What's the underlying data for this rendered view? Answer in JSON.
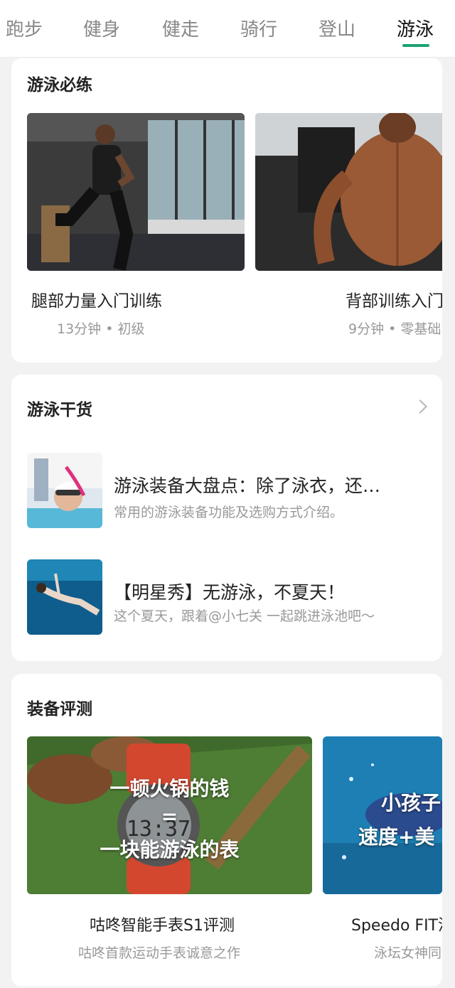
{
  "tabs": [
    {
      "label": "跑步"
    },
    {
      "label": "健身"
    },
    {
      "label": "健走"
    },
    {
      "label": "骑行"
    },
    {
      "label": "登山"
    },
    {
      "label": "游泳"
    }
  ],
  "active_tab": "游泳",
  "accent_color": "#1aa371",
  "section_must": {
    "title": "游泳必练",
    "courses": [
      {
        "name": "腿部力量入门训练",
        "meta": "13分钟 • 初级"
      },
      {
        "name": "背部训练入门",
        "meta": "9分钟 • 零基础"
      }
    ]
  },
  "section_tips": {
    "title": "游泳干货",
    "more_icon": "chevron-right-icon",
    "articles": [
      {
        "title": "游泳装备大盘点：除了泳衣，还…",
        "desc": "常用的游泳装备功能及选购方式介绍。"
      },
      {
        "title": "【明星秀】无游泳，不夏天！",
        "desc": "这个夏天，跟着@小七关 一起跳进泳池吧～"
      }
    ]
  },
  "section_review": {
    "title": "装备评测",
    "items": [
      {
        "overlay_line1": "一顿火锅的钱",
        "overlay_line2": "=",
        "overlay_line3": "一块能游泳的表",
        "watch_display": "13:37",
        "name": "咕咚智能手表S1评测",
        "desc": "咕咚首款运动手表诚意之作"
      },
      {
        "overlay_line1": "小孩子",
        "overlay_line2": "速度+美",
        "name": "Speedo FIT泳",
        "desc": "泳坛女神同"
      }
    ]
  }
}
